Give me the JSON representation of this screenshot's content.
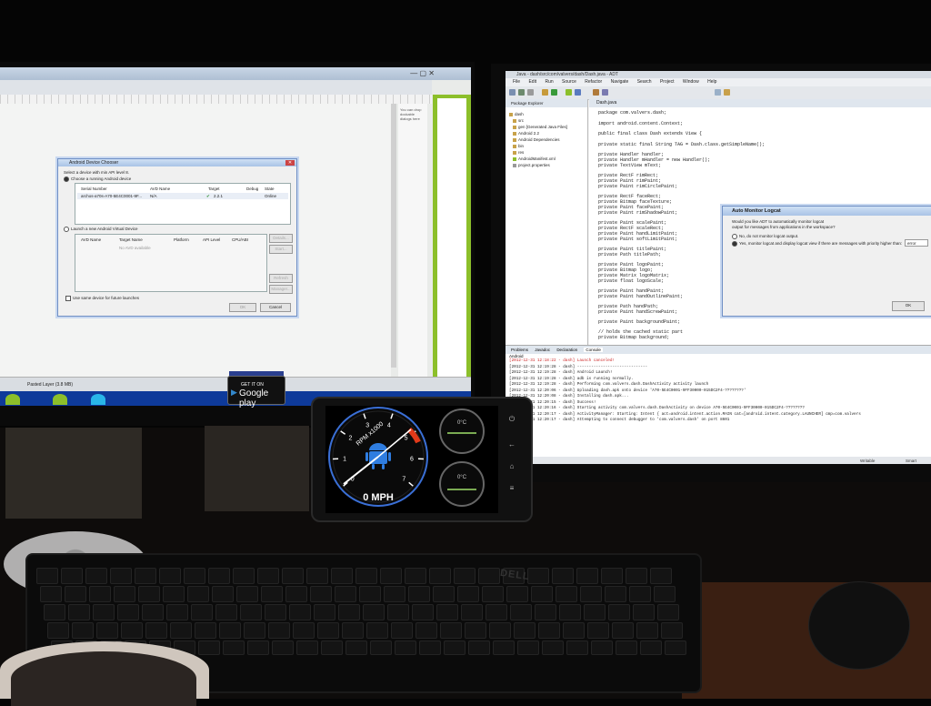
{
  "left_monitor": {
    "side_panel_text": "You can drop dockable dialogs here",
    "layer_label": "Pasted Layer (3.8 MB)",
    "google_play": {
      "small": "GET IT ON",
      "big": "Google play"
    },
    "dialog": {
      "title": "Android Device Chooser",
      "select_label": "Select a device with min API level 8.",
      "choose_running": "Choose a running Android device",
      "columns": [
        "Serial Number",
        "AVD Name",
        "Target",
        "Debug",
        "State"
      ],
      "device_row": [
        "archos-a70s-A70-5E4C0001-9F...",
        "N/A",
        "2.2.1",
        "",
        "Online"
      ],
      "launch_new": "Launch a new Android Virtual Device",
      "avd_columns": [
        "AVD Name",
        "Target Name",
        "Platform",
        "API Level",
        "CPU/ABI"
      ],
      "no_avd": "No AVD available",
      "side_buttons": [
        "Details...",
        "Start...",
        "Refresh",
        "Manager..."
      ],
      "same_device": "Use same device for future launches",
      "ok": "OK",
      "cancel": "Cancel"
    }
  },
  "right_monitor": {
    "window_title": "Java - dash/src/com/valvers/dash/Dash.java - ADT",
    "menu": [
      "File",
      "Edit",
      "Run",
      "Source",
      "Refactor",
      "Navigate",
      "Search",
      "Project",
      "Window",
      "Help"
    ],
    "package_explorer": {
      "tab": "Package Explorer",
      "items": [
        "dash",
        "src",
        "gen [Generated Java Files]",
        "Android 2.2",
        "Android Dependencies",
        "bin",
        "res",
        "AndroidManifest.xml",
        "project.properties"
      ]
    },
    "editor": {
      "tab": "Dash.java",
      "lines": [
        "package com.valvers.dash;",
        "import android.content.Context;",
        "public final class Dash extends View {",
        "    private static final String TAG = Dash.class.getSimpleName();",
        "    private Handler handler;",
        "    private Handler mHandler = new Handler();",
        "    private TextView mText;",
        "    private RectF rimRect;",
        "    private Paint rimPaint;",
        "    private Paint rimCirclePaint;",
        "    private RectF faceRect;",
        "    private Bitmap faceTexture;",
        "    private Paint facePaint;",
        "    private Paint rimShadowPaint;",
        "    private Paint scalePaint;",
        "    private RectF scaleRect;",
        "    private Paint handLimitPaint;",
        "    private Paint softLimitPaint;",
        "    private Paint titlePaint;",
        "    private Path titlePath;",
        "    private Paint logoPaint;",
        "    private Bitmap logo;",
        "    private Matrix logoMatrix;",
        "    private float logoScale;",
        "    private Paint handPaint;",
        "    private Paint handOutlinePaint;",
        "    private Path handPath;",
        "    private Paint handScrewPaint;",
        "    private Paint backgroundPaint;",
        "    // holds the cached static part",
        "    private Bitmap background;"
      ]
    },
    "logcat_dialog": {
      "title": "Auto Monitor Logcat",
      "question": "Would you like ADT to automatically monitor logcat",
      "question2": "output for messages from applications in the workspace?",
      "option_no": "No, do not monitor logcat output.",
      "option_yes": "Yes, monitor logcat and display logcat view if there are messages with priority higher than:",
      "level": "error",
      "ok": "OK"
    },
    "bottom_tabs": [
      "Problems",
      "Javadoc",
      "Declaration",
      "Console"
    ],
    "console_label": "Android",
    "console_lines": [
      "[2012-12-31 12:18:22 - dash] Launch canceled!",
      "[2012-12-31 12:19:28 - dash] ------------------------------",
      "[2012-12-31 12:19:28 - dash] Android Launch!",
      "[2012-12-31 12:19:28 - dash] adb is running normally.",
      "[2012-12-31 12:19:28 - dash] Performing com.valvers.dash.DashActivity activity launch",
      "[2012-12-31 12:20:06 - dash] Uploading dash.apk onto device 'A70-5E4C0001-9FF30000-015DC2F4-????????'",
      "[2012-12-31 12:20:08 - dash] Installing dash.apk...",
      "[2012-12-31 12:20:15 - dash] Success!",
      "[2012-12-31 12:20:16 - dash] Starting activity com.valvers.dash.DashActivity on device A70-5E4C0001-9FF30000-015DC2F4-????????",
      "[2012-12-31 12:20:17 - dash] ActivityManager: Starting: Intent { act=android.intent.action.MAIN cat=[android.intent.category.LAUNCHER] cmp=com.valvers",
      "[2012-12-31 12:20:17 - dash] Attempting to connect debugger to 'com.valvers.dash' on port 8601"
    ],
    "status": [
      "Writable",
      "Smart"
    ]
  },
  "phone": {
    "gauge_label": "RPM x1000",
    "speed": "0 MPH",
    "small_gauge_1": "0°C",
    "small_gauge_2": "0°C",
    "ticks": [
      "0",
      "1",
      "2",
      "3",
      "4",
      "5",
      "6",
      "7"
    ],
    "buttons": [
      "power-icon",
      "back-icon",
      "home-icon",
      "menu-icon"
    ]
  },
  "desk": {
    "keyboard_brand": "DELL"
  },
  "colors": {
    "needle": "#ffffff",
    "redline": "#e23a1a",
    "gauge_ring": "#3a6fd6",
    "android_green": "#8cbf2a"
  }
}
